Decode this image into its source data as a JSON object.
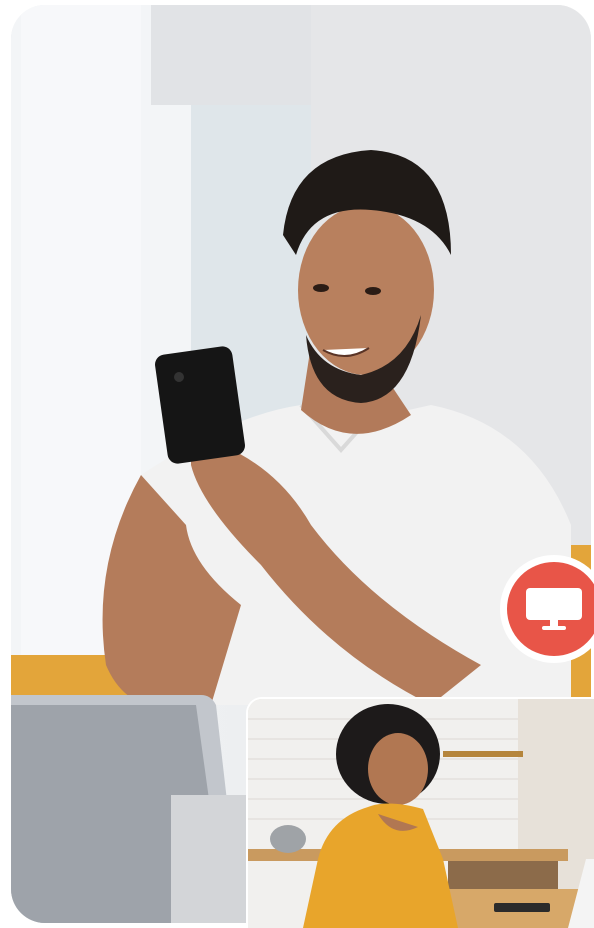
{
  "scene": {
    "main_photo_subject": "",
    "pip_photo_subject": ""
  },
  "badge": {
    "icon": "monitor-icon",
    "color": "#e85548"
  }
}
